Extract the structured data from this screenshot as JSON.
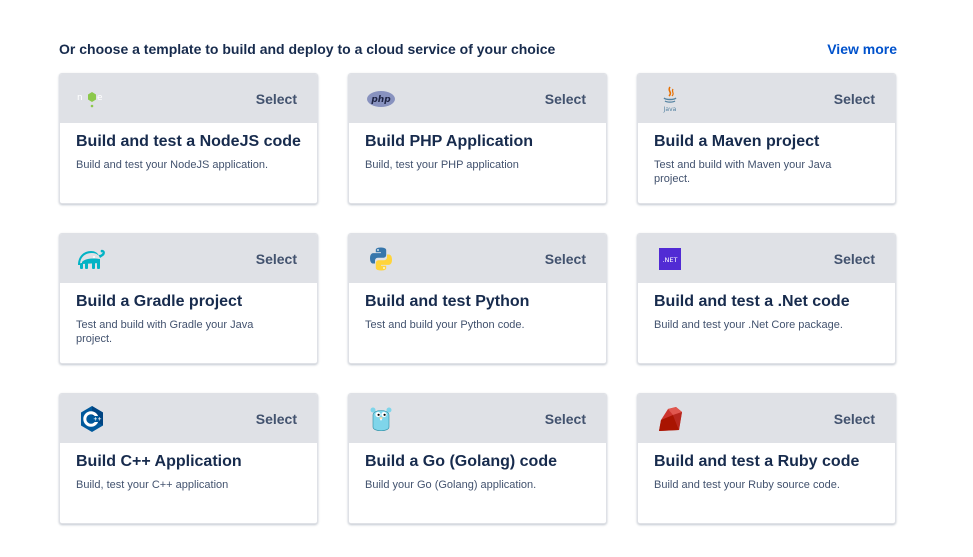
{
  "header": {
    "title": "Or choose a template to build and deploy to a cloud service of your choice",
    "view_more": "View more"
  },
  "select_label": "Select",
  "cards": [
    {
      "title": "Build and test a NodeJS code",
      "description": "Build and test your NodeJS application.",
      "icon": "nodejs-icon"
    },
    {
      "title": "Build PHP Application",
      "description": "Build, test your PHP application",
      "icon": "php-icon",
      "icon_text": "php"
    },
    {
      "title": "Build a Maven project",
      "description": "Test and build with Maven your Java project.",
      "icon": "java-icon",
      "icon_text": "Java"
    },
    {
      "title": "Build a Gradle project",
      "description": "Test and build with Gradle your Java project.",
      "icon": "gradle-icon"
    },
    {
      "title": "Build and test Python",
      "description": "Test and build your Python code.",
      "icon": "python-icon"
    },
    {
      "title": "Build and test a .Net code",
      "description": "Build and test your .Net Core package.",
      "icon": "dotnet-icon",
      "icon_text": ".NET"
    },
    {
      "title": "Build C++ Application",
      "description": "Build, test your C++ application",
      "icon": "cpp-icon"
    },
    {
      "title": "Build a Go (Golang) code",
      "description": "Build your Go (Golang) application.",
      "icon": "golang-icon"
    },
    {
      "title": "Build and test a Ruby code",
      "description": "Build and test your Ruby source code.",
      "icon": "ruby-icon"
    }
  ],
  "colors": {
    "accent": "#0052cc",
    "card_header": "#dfe1e6",
    "text_primary": "#172b4d",
    "text_secondary": "#42526e"
  }
}
